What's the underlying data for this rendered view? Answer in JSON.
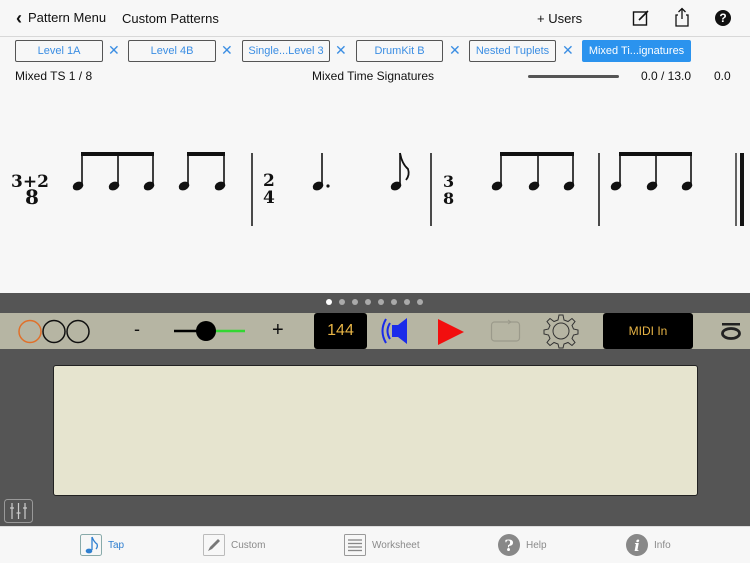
{
  "navbar": {
    "back_label": "Pattern Menu",
    "title": "Custom Patterns",
    "users_label": "+ Users",
    "icons": [
      "compose-icon",
      "share-icon",
      "help-icon"
    ]
  },
  "tabs": [
    {
      "label": "Level 1A",
      "active": false
    },
    {
      "label": "Level 4B",
      "active": false
    },
    {
      "label": "Single...Level 3",
      "active": false
    },
    {
      "label": "DrumKit B",
      "active": false
    },
    {
      "label": "Nested Tuplets",
      "active": false
    },
    {
      "label": "Mixed Ti...ignatures",
      "active": true
    }
  ],
  "tab_close_glyph": "✕",
  "info": {
    "pattern_position": "Mixed TS 1 / 8",
    "pattern_name": "Mixed Time Signatures",
    "time_readout": "0.0 / 13.0",
    "score_readout": "0.0",
    "progress_fraction": 0.0
  },
  "score": {
    "measures": [
      {
        "time_signature": {
          "top": "3+2",
          "bottom": "8"
        },
        "notes": "beamed eighths 3 + 2"
      },
      {
        "time_signature": {
          "top": "2",
          "bottom": "4"
        },
        "notes": "dotted quarter, eighth"
      },
      {
        "time_signature": {
          "top": "3",
          "bottom": "8"
        },
        "notes": "beamed eighths 3"
      },
      {
        "time_signature": null,
        "notes": "beamed eighths 3"
      }
    ]
  },
  "pager": {
    "count": 8,
    "active_index": 0
  },
  "toolbar": {
    "count_in_circles": 3,
    "count_in_active": 0,
    "minus_label": "-",
    "plus_label": "+",
    "slider_fraction": 0.45,
    "tempo": "144",
    "midi_label": "MIDI In",
    "colors": {
      "accent_orange": "#e0702a",
      "tempo_text": "#e7b446",
      "play": "#f20e0e",
      "speaker": "#1a2bea",
      "slider_green": "#33d633"
    }
  },
  "bottom_tabs": [
    {
      "label": "Tap",
      "icon": "eighth-note-icon",
      "active": true
    },
    {
      "label": "Custom",
      "icon": "pencil-icon",
      "active": false
    },
    {
      "label": "Worksheet",
      "icon": "list-icon",
      "active": false
    },
    {
      "label": "Help",
      "icon": "question-icon",
      "active": false
    },
    {
      "label": "Info",
      "icon": "info-icon",
      "active": false
    }
  ]
}
